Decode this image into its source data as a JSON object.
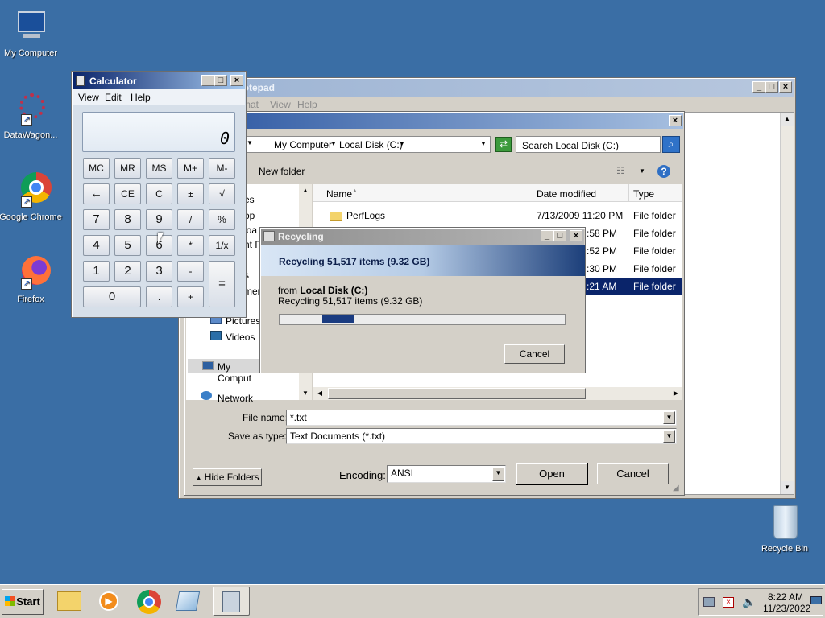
{
  "desktop": {
    "icons": [
      {
        "label": "My Computer",
        "icon": "computer-icon"
      },
      {
        "label": "DataWagon...",
        "icon": "datawagon-icon"
      },
      {
        "label": "Google Chrome",
        "icon": "chrome-icon"
      },
      {
        "label": "Firefox",
        "icon": "firefox-icon"
      },
      {
        "label": "Recycle Bin",
        "icon": "recycle-bin-icon"
      }
    ]
  },
  "notepad": {
    "title": "Notepad",
    "menu": [
      "Format",
      "View",
      "Help"
    ]
  },
  "open_dialog": {
    "breadcrumb": [
      "My Computer",
      "Local Disk (C:)"
    ],
    "search_placeholder": "Search Local Disk (C:)",
    "new_folder": "New folder",
    "columns": [
      "Name",
      "Date modified",
      "Type"
    ],
    "nav_items": [
      "es",
      "op",
      "loa",
      "nt P",
      "s",
      "mer",
      "Pictures",
      "Videos",
      "My Comput",
      "Network"
    ],
    "files": [
      {
        "name": "PerfLogs",
        "date": "7/13/2009 11:20 PM",
        "type": "File folder"
      },
      {
        "name": "",
        "date": ":58 PM",
        "type": "File folder"
      },
      {
        "name": "",
        "date": ":52 PM",
        "type": "File folder"
      },
      {
        "name": "",
        "date": ":30 PM",
        "type": "File folder"
      },
      {
        "name": "",
        "date": ":21 AM",
        "type": "File folder"
      }
    ],
    "file_name_label": "File name:",
    "file_name_value": "*.txt",
    "save_as_label": "Save as type:",
    "save_as_value": "Text Documents (*.txt)",
    "encoding_label": "Encoding:",
    "encoding_value": "ANSI",
    "hide_folders": "Hide Folders",
    "open": "Open",
    "cancel": "Cancel"
  },
  "calculator": {
    "title": "Calculator",
    "menu": [
      "View",
      "Edit",
      "Help"
    ],
    "display": "0",
    "keys": [
      [
        "MC",
        "MR",
        "MS",
        "M+",
        "M-"
      ],
      [
        "←",
        "CE",
        "C",
        "±",
        "√"
      ],
      [
        "7",
        "8",
        "9",
        "/",
        "%"
      ],
      [
        "4",
        "5",
        "6",
        "*",
        "1/x"
      ],
      [
        "1",
        "2",
        "3",
        "-",
        "="
      ],
      [
        "0",
        ".",
        "+"
      ]
    ]
  },
  "recycling": {
    "title": "Recycling",
    "header": "Recycling 51,517 items (9.32 GB)",
    "from_label": "from ",
    "from_value": "Local Disk (C:)",
    "detail": "Recycling 51,517 items (9.32 GB)",
    "progress": 0.11,
    "cancel": "Cancel"
  },
  "taskbar": {
    "start": "Start",
    "time": "8:22 AM",
    "date": "11/23/2022"
  }
}
